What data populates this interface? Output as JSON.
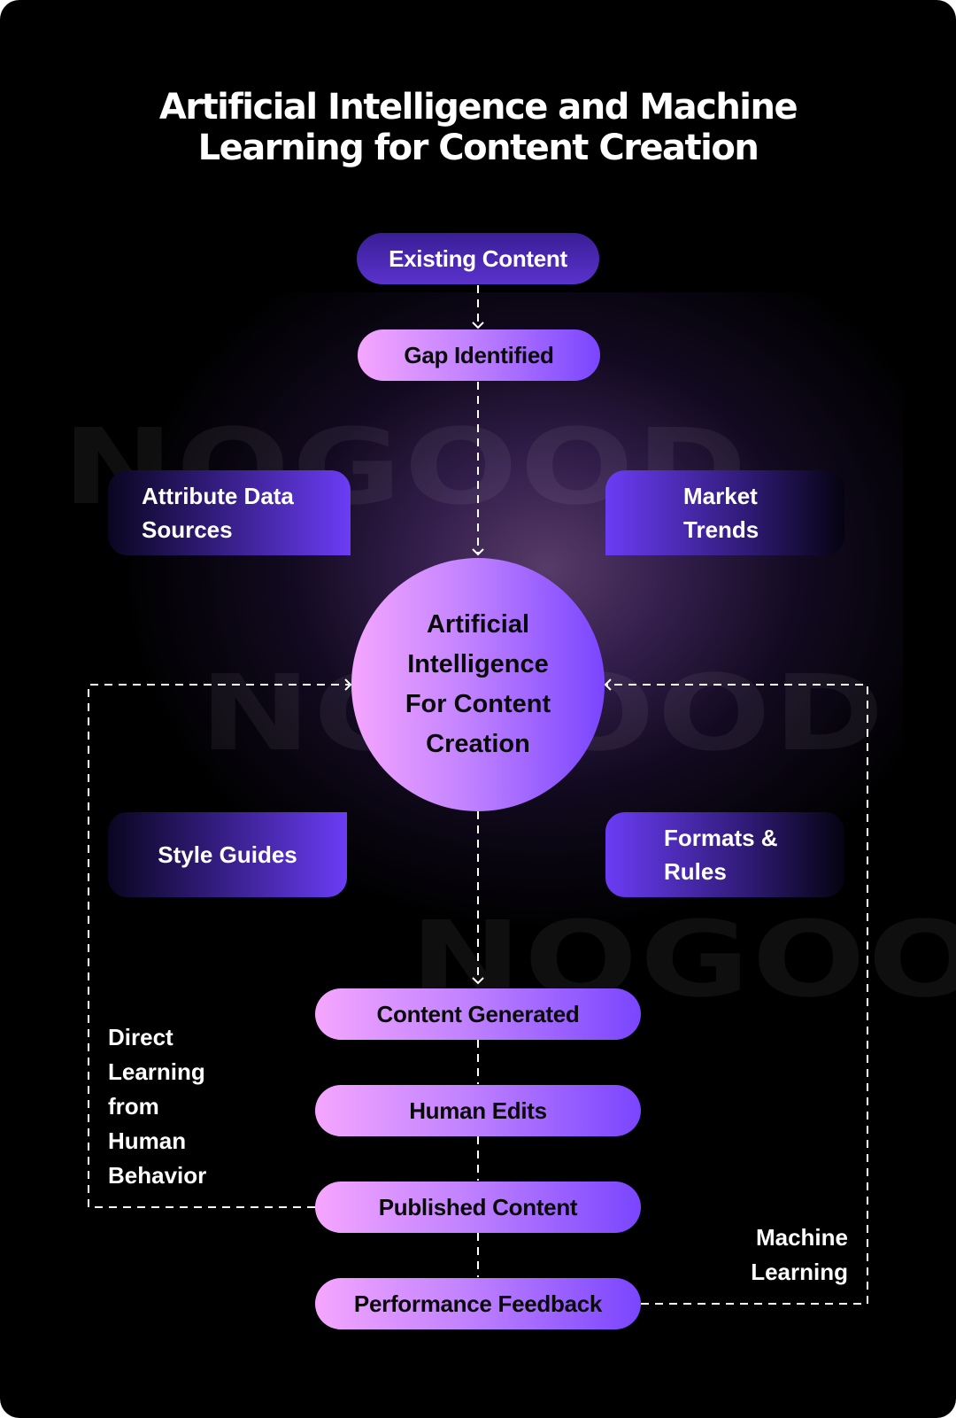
{
  "title": {
    "line1": "Artificial Intelligence and Machine",
    "line2": "Learning for Content Creation"
  },
  "watermark": "NOGOOD",
  "top_flow": {
    "existing_content": "Existing Content",
    "gap_identified": "Gap Identified"
  },
  "inputs": {
    "attribute_data_sources": [
      "Attribute Data",
      "Sources"
    ],
    "market_trends": [
      "Market",
      "Trends"
    ],
    "style_guides": [
      "Style Guides"
    ],
    "formats_rules": [
      "Formats &",
      "Rules"
    ]
  },
  "center": {
    "lines": [
      "Artificial",
      "Intelligence",
      "For Content",
      "Creation"
    ]
  },
  "bottom_flow": {
    "content_generated": "Content Generated",
    "human_edits": "Human Edits",
    "published_content": "Published Content",
    "performance_feedback": "Performance Feedback"
  },
  "loops": {
    "direct_learning": [
      "Direct",
      "Learning",
      "from",
      "Human",
      "Behavior"
    ],
    "machine_learning": [
      "Machine",
      "Learning"
    ]
  },
  "colors": {
    "background": "#000000",
    "pill_gradient_start": "#f5a6ff",
    "pill_gradient_end": "#7a45ff",
    "dark_pill": "#4a28b4",
    "accent_purple": "#6b3cf5",
    "text_light": "#ffffff",
    "text_dark": "#0a0a0a"
  }
}
